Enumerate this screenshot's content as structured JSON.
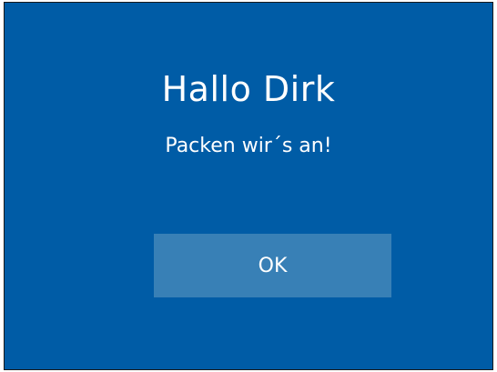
{
  "dialog": {
    "greeting": "Hallo Dirk",
    "message": "Packen wir´s an!",
    "ok_label": "OK"
  },
  "colors": {
    "background": "#005ca6",
    "button": "#3880b6",
    "text": "#ffffff"
  }
}
